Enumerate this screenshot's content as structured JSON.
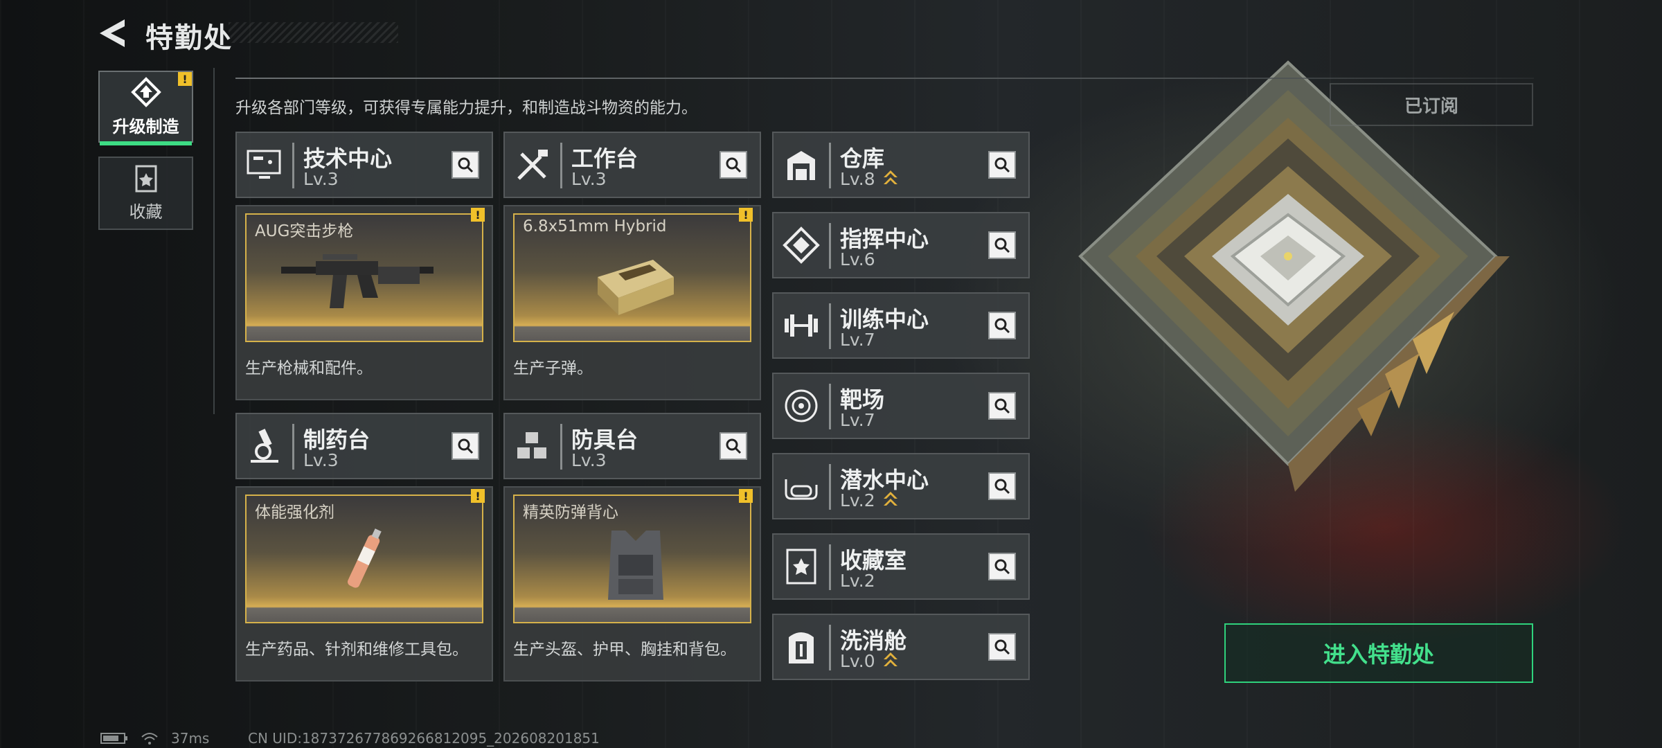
{
  "header": {
    "title": "特勤处"
  },
  "nav": [
    {
      "label": "升级制造",
      "active": true,
      "alert": "!"
    },
    {
      "label": "收藏",
      "active": false
    }
  ],
  "intro": "升级各部门等级，可获得专属能力提升，和制造战斗物资的能力。",
  "subscribed_label": "已订阅",
  "departments": {
    "tech": {
      "name": "技术中心",
      "level": "Lv.3"
    },
    "workbench": {
      "name": "工作台",
      "level": "Lv.3"
    },
    "pharmacy": {
      "name": "制药台",
      "level": "Lv.3"
    },
    "armor": {
      "name": "防具台",
      "level": "Lv.3"
    },
    "side": [
      {
        "name": "仓库",
        "level": "Lv.8",
        "upgradable": true,
        "icon": "warehouse-icon"
      },
      {
        "name": "指挥中心",
        "level": "Lv.6",
        "upgradable": false,
        "icon": "command-center-icon"
      },
      {
        "name": "训练中心",
        "level": "Lv.7",
        "upgradable": false,
        "icon": "dumbbell-icon"
      },
      {
        "name": "靶场",
        "level": "Lv.7",
        "upgradable": false,
        "icon": "target-icon"
      },
      {
        "name": "潜水中心",
        "level": "Lv.2",
        "upgradable": true,
        "icon": "diving-mask-icon"
      },
      {
        "name": "收藏室",
        "level": "Lv.2",
        "upgradable": false,
        "icon": "collection-room-icon"
      },
      {
        "name": "洗消舱",
        "level": "Lv.0",
        "upgradable": true,
        "icon": "decon-chamber-icon"
      }
    ]
  },
  "products": {
    "tech": {
      "item": "AUG突击步枪",
      "desc": "生产枪械和配件。",
      "alert": "!"
    },
    "workbench": {
      "item": "6.8x51mm Hybrid",
      "desc": "生产子弹。",
      "alert": "!"
    },
    "pharmacy": {
      "item": "体能强化剂",
      "desc": "生产药品、针剂和维修工具包。",
      "alert": "!"
    },
    "armor": {
      "item": "精英防弹背心",
      "desc": "生产头盔、护甲、胸挂和背包。",
      "alert": "!"
    }
  },
  "enter_button": "进入特勤处",
  "status_bar": {
    "ping": "37ms",
    "uid": "CN UID:187372677869266812095_202608201851"
  },
  "colors": {
    "accent": "#3ddc84",
    "alert": "#f0c02a",
    "gold": "#d6b24a"
  }
}
